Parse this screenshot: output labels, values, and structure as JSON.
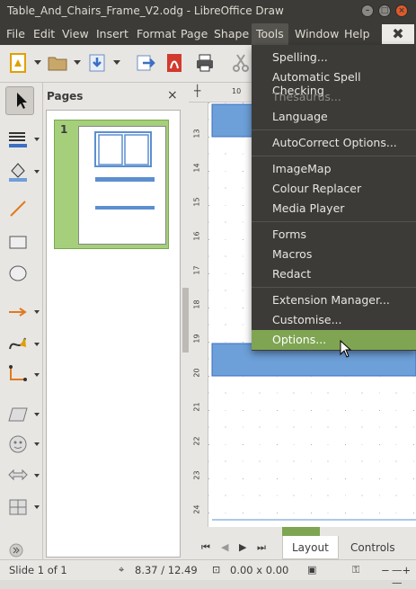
{
  "window": {
    "title": "Table_And_Chairs_Frame_V2.odg - LibreOffice Draw"
  },
  "menubar": {
    "items": [
      "File",
      "Edit",
      "View",
      "Insert",
      "Format",
      "Page",
      "Shape",
      "Tools",
      "Window",
      "Help"
    ],
    "active": "Tools"
  },
  "tools_menu": {
    "items": [
      {
        "label": "Spelling...",
        "state": "normal"
      },
      {
        "label": "Automatic Spell Checking",
        "state": "normal"
      },
      {
        "label": "Thesaurus...",
        "state": "disabled"
      },
      {
        "label": "Language",
        "state": "normal"
      },
      {
        "label": "AutoCorrect Options...",
        "state": "normal"
      },
      {
        "label": "ImageMap",
        "state": "normal"
      },
      {
        "label": "Colour Replacer",
        "state": "normal"
      },
      {
        "label": "Media Player",
        "state": "normal"
      },
      {
        "label": "Forms",
        "state": "normal"
      },
      {
        "label": "Macros",
        "state": "normal"
      },
      {
        "label": "Redact",
        "state": "normal"
      },
      {
        "label": "Extension Manager...",
        "state": "normal"
      },
      {
        "label": "Customise...",
        "state": "normal"
      },
      {
        "label": "Options...",
        "state": "hover"
      }
    ]
  },
  "pages_panel": {
    "title": "Pages",
    "close_glyph": "×",
    "page_numbers": [
      "1"
    ]
  },
  "ruler": {
    "horizontal_labels": [
      "10"
    ],
    "vertical_labels": [
      "13",
      "14",
      "15",
      "16",
      "17",
      "18",
      "19",
      "20",
      "21",
      "22",
      "23",
      "24"
    ]
  },
  "tabs": {
    "items": [
      "Layout",
      "Controls"
    ],
    "active": "Layout"
  },
  "statusbar": {
    "slide": "Slide 1 of 1",
    "position": "8.37 / 12.49",
    "size": "0.00 x 0.00"
  },
  "colors": {
    "titlebar": "#3c3b37",
    "menu_highlight": "#7fa553",
    "thumbnail_bg": "#a5cf7b",
    "shape_blue": "#5b8fd0"
  }
}
